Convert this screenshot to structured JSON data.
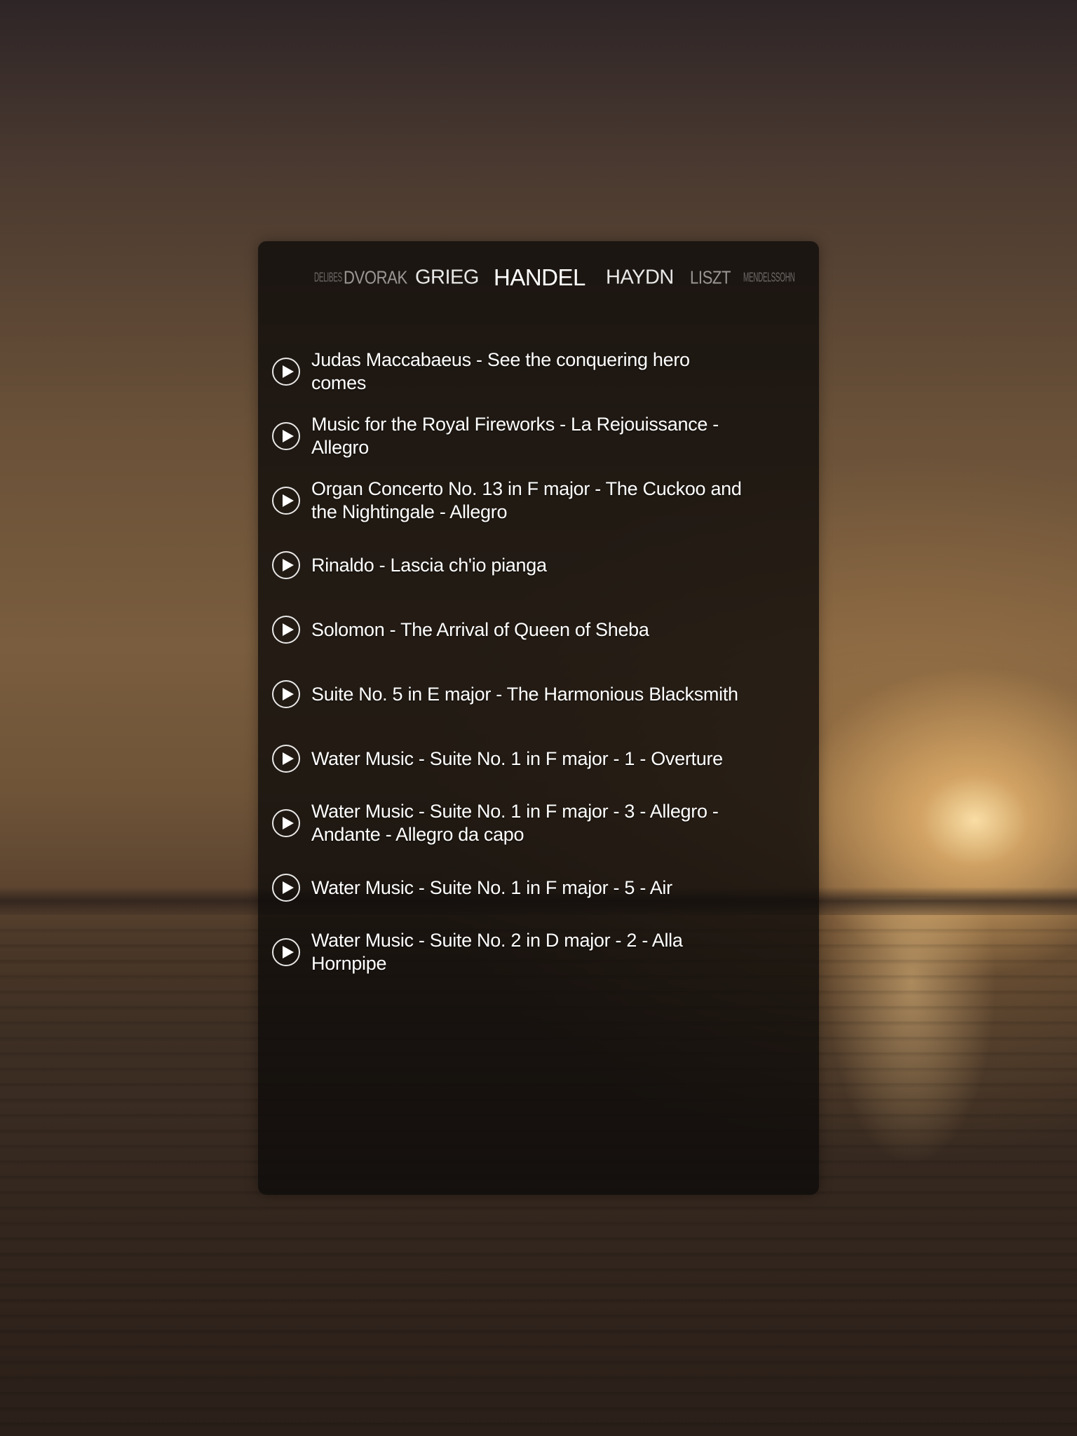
{
  "composer_nav": {
    "items": [
      {
        "label": "DELIBES"
      },
      {
        "label": "DVORAK"
      },
      {
        "label": "GRIEG"
      },
      {
        "label": "HANDEL"
      },
      {
        "label": "HAYDN"
      },
      {
        "label": "LISZT"
      },
      {
        "label": "MENDELSSOHN"
      }
    ],
    "selected": "HANDEL"
  },
  "tracks": [
    {
      "title": "Judas Maccabaeus - See the conquering hero comes"
    },
    {
      "title": "Music for the Royal Fireworks - La Rejouissance - Allegro"
    },
    {
      "title": "Organ Concerto No. 13 in F major - The Cuckoo and the Nightingale - Allegro"
    },
    {
      "title": "Rinaldo - Lascia ch'io pianga"
    },
    {
      "title": "Solomon - The Arrival of Queen of Sheba"
    },
    {
      "title": "Suite No. 5 in E major - The Harmonious Blacksmith"
    },
    {
      "title": "Water Music - Suite No. 1 in F major - 1 - Overture"
    },
    {
      "title": "Water Music - Suite No. 1 in F major - 3 - Allegro - Andante - Allegro da capo"
    },
    {
      "title": "Water Music - Suite No. 1 in F major - 5 - Air"
    },
    {
      "title": "Water Music - Suite No. 2 in D major - 2 - Alla Hornpipe"
    }
  ],
  "icons": {
    "play": "play-circle-icon"
  },
  "colors": {
    "text": "#ffffff",
    "panel": "#0e0b0a"
  }
}
